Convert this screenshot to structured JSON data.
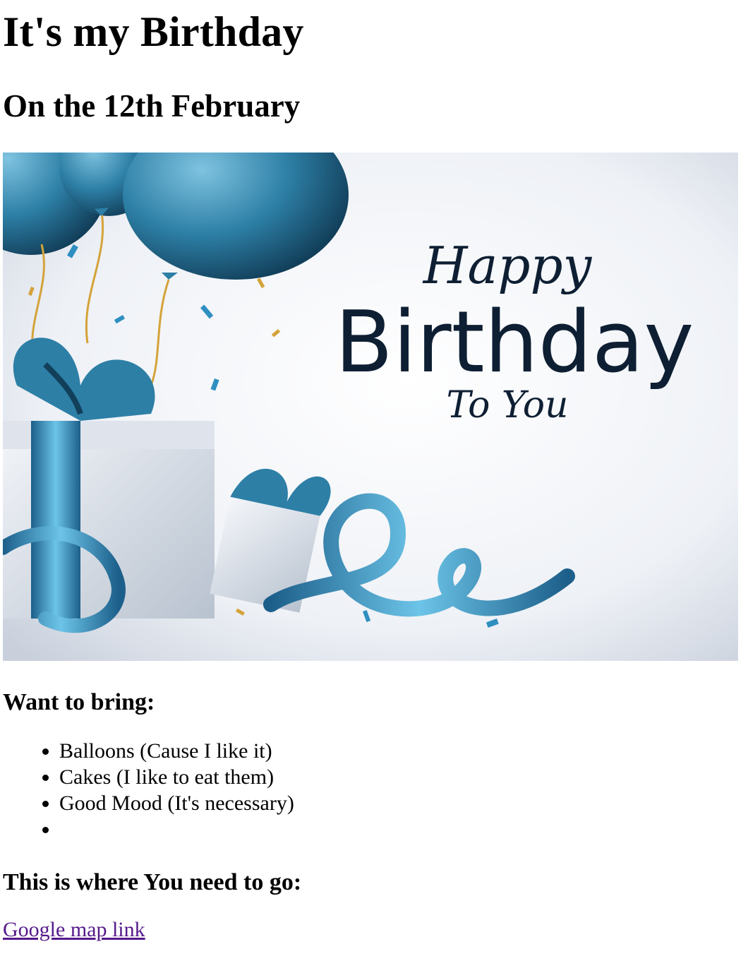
{
  "heading": "It's my Birthday",
  "subheading": "On the 12th February",
  "banner": {
    "line1": "Happy",
    "line2": "Birthday",
    "line3": "To You",
    "accent_color": "#2e8fc0",
    "text_color": "#0e1f33",
    "ribbon_gold": "#d4a33a"
  },
  "bring": {
    "title": "Want to bring:",
    "items": [
      "Balloons (Cause I like it)",
      "Cakes (I like to eat them)",
      "Good Mood (It's necessary)",
      ""
    ]
  },
  "directions": {
    "title": "This is where You need to go:",
    "link_text": "Google map link",
    "link_color": "#551a8b"
  }
}
